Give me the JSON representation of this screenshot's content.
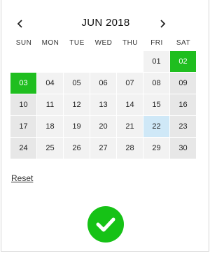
{
  "calendar": {
    "month_label": "JUN 2018",
    "weekdays": [
      "SUN",
      "MON",
      "TUE",
      "WED",
      "THU",
      "FRI",
      "SAT"
    ],
    "weeks": [
      [
        "",
        "",
        "",
        "",
        "",
        "01",
        "02"
      ],
      [
        "03",
        "04",
        "05",
        "06",
        "07",
        "08",
        "09"
      ],
      [
        "10",
        "11",
        "12",
        "13",
        "14",
        "15",
        "16"
      ],
      [
        "17",
        "18",
        "19",
        "20",
        "21",
        "22",
        "23"
      ],
      [
        "24",
        "25",
        "26",
        "27",
        "28",
        "29",
        "30"
      ]
    ],
    "selected_days": [
      "02",
      "03"
    ],
    "today": "22"
  },
  "actions": {
    "reset_label": "Reset",
    "prev_icon": "chevron-left-icon",
    "next_icon": "chevron-right-icon",
    "confirm_icon": "checkmark-icon"
  },
  "colors": {
    "selected": "#1fbe1f",
    "today": "#cfe8f7",
    "confirm": "#16c216"
  }
}
